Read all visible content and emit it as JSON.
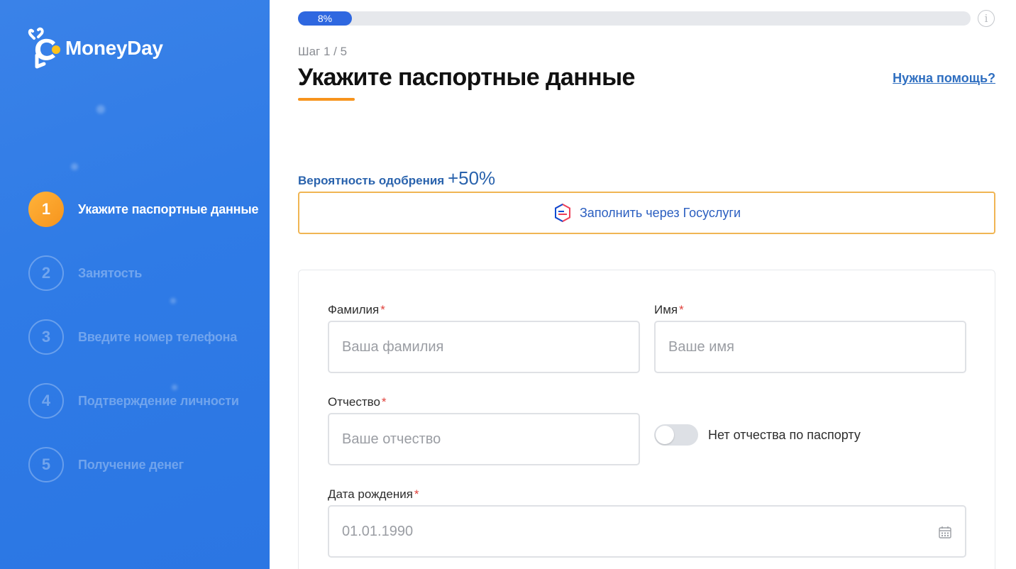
{
  "brand": {
    "name": "MoneyDay"
  },
  "sidebar": {
    "steps": [
      {
        "num": "1",
        "label": "Укажите паспортные данные"
      },
      {
        "num": "2",
        "label": "Занятость"
      },
      {
        "num": "3",
        "label": "Введите номер телефона"
      },
      {
        "num": "4",
        "label": "Подтверждение личности"
      },
      {
        "num": "5",
        "label": "Получение денег"
      }
    ]
  },
  "progress": {
    "percent": 8,
    "label": "8%"
  },
  "header": {
    "step_counter": "Шаг 1 / 5",
    "title": "Укажите паспортные данные",
    "help_link": "Нужна помощь?"
  },
  "approval": {
    "label": "Вероятность одобрения",
    "value": "+50%"
  },
  "gosuslugi": {
    "label": "Заполнить через Госуслуги"
  },
  "form": {
    "required_mark": "*",
    "last_name": {
      "label": "Фамилия",
      "placeholder": "Ваша фамилия"
    },
    "first_name": {
      "label": "Имя",
      "placeholder": "Ваше имя"
    },
    "middle_name": {
      "label": "Отчество",
      "placeholder": "Ваше отчество"
    },
    "no_middle_name": {
      "label": "Нет отчества по паспорту",
      "checked": false
    },
    "birth_date": {
      "label": "Дата рождения",
      "placeholder": "01.01.1990"
    }
  },
  "colors": {
    "sidebar_bg": "#2f7be6",
    "accent_orange": "#f7941d",
    "progress_blue": "#2e67e0",
    "link_blue": "#2e6ec0"
  }
}
